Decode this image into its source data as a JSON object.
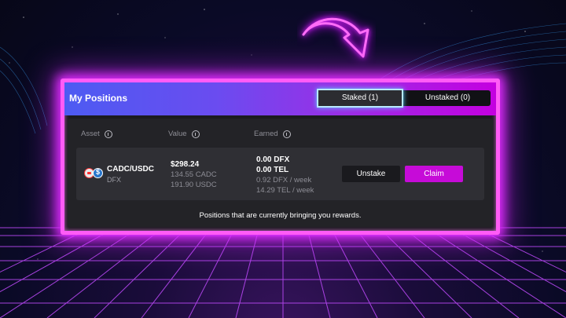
{
  "positions": {
    "title": "My Positions",
    "tabs": [
      {
        "label": "Staked (1)",
        "active": true
      },
      {
        "label": "Unstaked (0)",
        "active": false
      }
    ],
    "columns": [
      "Asset",
      "Value",
      "Earned"
    ],
    "rows": [
      {
        "asset_name": "CADC/USDC",
        "asset_sub": "DFX",
        "value_total": "$298.24",
        "value_cadc": "134.55 CADC",
        "value_usdc": "191.90 USDC",
        "earned_dfx": "0.00 DFX",
        "earned_tel": "0.00 TEL",
        "rate_dfx": "0.92 DFX / week",
        "rate_tel": "14.29 TEL / week",
        "unstake_label": "Unstake",
        "claim_label": "Claim"
      }
    ],
    "footer_note": "Positions that are currently bringing you rewards."
  },
  "icons": {
    "arrow": "curved-arrow-icon",
    "info": "info-icon",
    "cadc": "cadc-token-icon",
    "usdc": "usdc-token-icon"
  },
  "colors": {
    "neon_frame": "#ff5cf6",
    "header_start": "#4d5bf2",
    "header_end": "#c400e0",
    "claim_button": "#c60bd8",
    "active_tab_glow": "#58d2ff"
  }
}
